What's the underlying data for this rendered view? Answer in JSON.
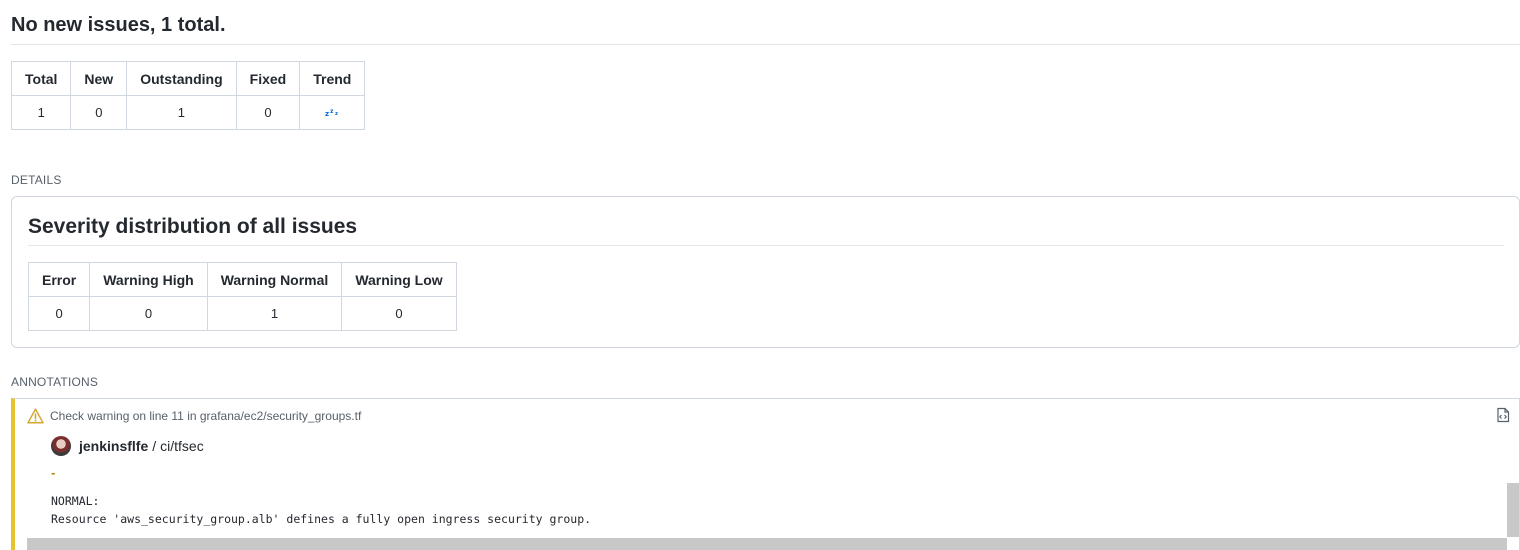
{
  "header": {
    "title": "No new issues, 1 total."
  },
  "summary_table": {
    "headers": [
      "Total",
      "New",
      "Outstanding",
      "Fixed",
      "Trend"
    ],
    "values": [
      "1",
      "0",
      "1",
      "0"
    ],
    "trend_icon": "sleep-zzz-icon"
  },
  "details": {
    "section_label": "DETAILS",
    "title": "Severity distribution of all issues",
    "headers": [
      "Error",
      "Warning High",
      "Warning Normal",
      "Warning Low"
    ],
    "values": [
      "0",
      "0",
      "1",
      "0"
    ]
  },
  "annotations": {
    "section_label": "ANNOTATIONS",
    "item": {
      "summary": "Check warning on line 11 in grafana/ec2/security_groups.tf",
      "author": "jenkinsflfe",
      "separator": "/",
      "repo": "ci/tfsec",
      "dash": "-",
      "message_line1": "NORMAL:",
      "message_line2": "Resource 'aws_security_group.alb' defines a fully open ingress security group.",
      "accent_color": "#e8c22c"
    }
  }
}
